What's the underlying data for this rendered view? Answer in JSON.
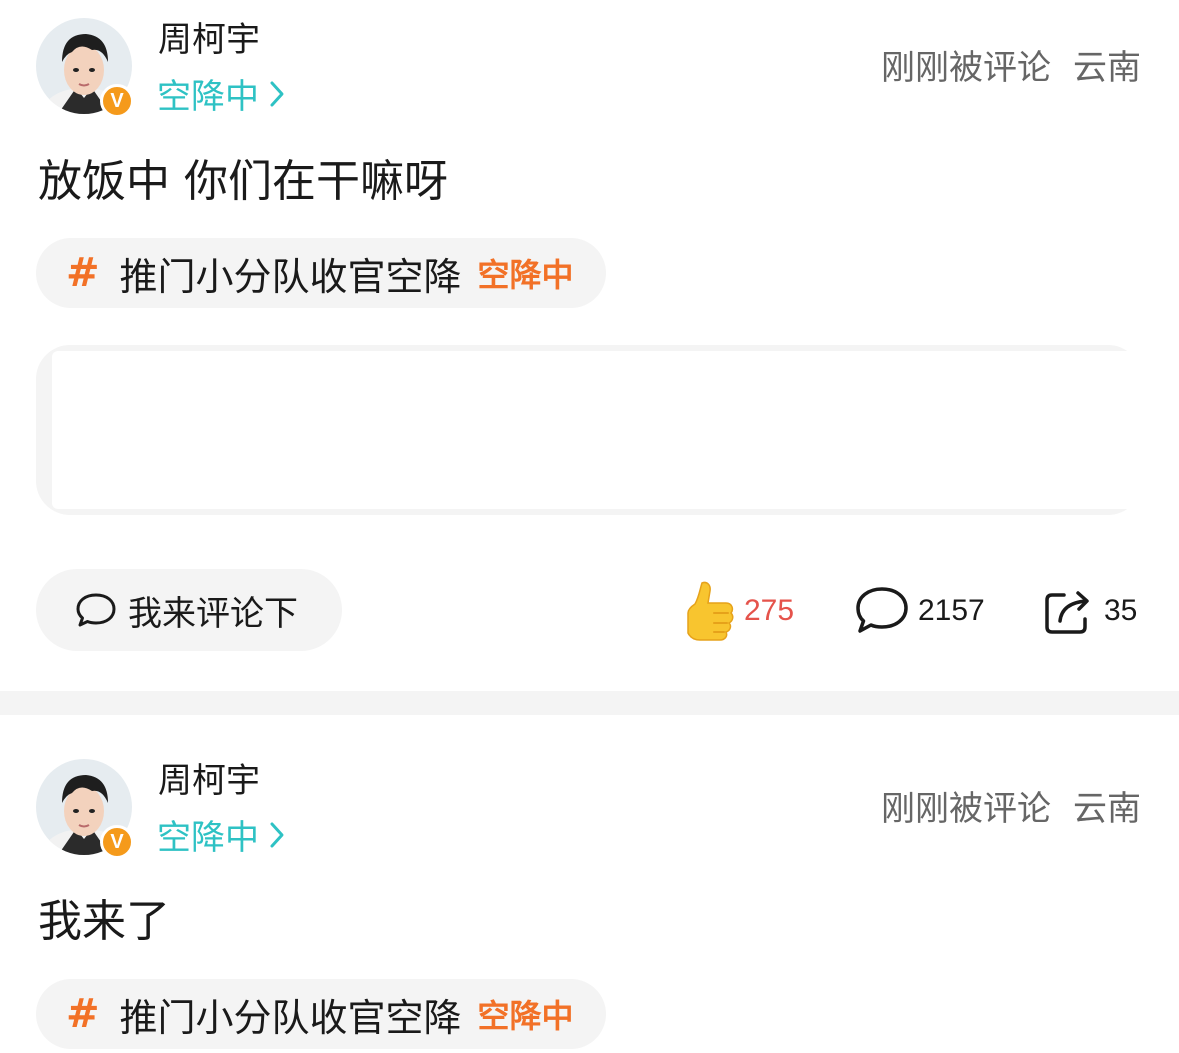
{
  "posts": [
    {
      "username": "周柯宇",
      "status": "空降中",
      "meta_time": "刚刚被评论",
      "meta_location": "云南",
      "content": "放饭中 你们在干嘛呀",
      "topic": {
        "title": "推门小分队收官空降",
        "badge": "空降中"
      },
      "verified_mark": "V"
    },
    {
      "username": "周柯宇",
      "status": "空降中",
      "meta_time": "刚刚被评论",
      "meta_location": "云南",
      "content": "我来了",
      "topic": {
        "title": "推门小分队收官空降",
        "badge": "空降中"
      },
      "verified_mark": "V"
    }
  ],
  "actions": {
    "comment_placeholder": "我来评论下",
    "likes": "275",
    "comments": "2157",
    "shares": "35"
  },
  "colors": {
    "accent_teal": "#2ec2c4",
    "topic_orange": "#f27127",
    "like_red": "#e5534b",
    "badge_orange": "#f59a1b"
  },
  "icons": [
    "chevron-right-icon",
    "hash-icon",
    "comment-bubble-icon",
    "thumbs-up-icon",
    "share-icon",
    "verified-badge-icon"
  ]
}
